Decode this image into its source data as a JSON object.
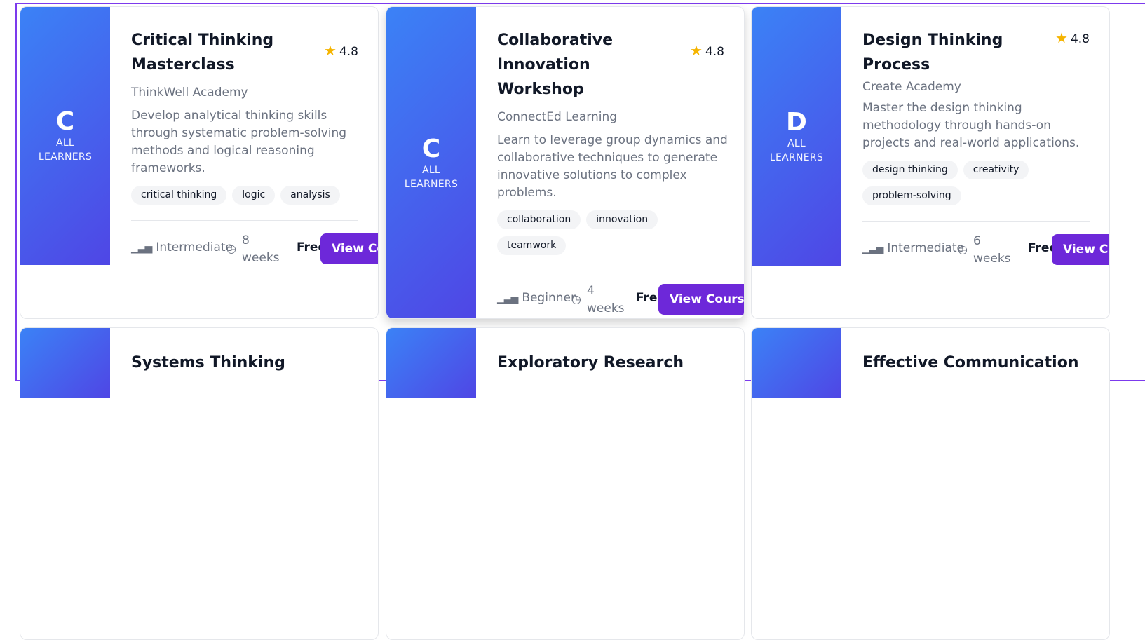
{
  "cards": [
    {
      "letter": "C",
      "audience": "ALL LEARNERS",
      "title": "Critical Thinking Masterclass",
      "rating": "4.8",
      "provider": "ThinkWell Academy",
      "description": "Develop analytical thinking skills through systematic problem-solving methods and logical reasoning frameworks.",
      "tags": [
        "critical thinking",
        "logic",
        "analysis"
      ],
      "level": "Intermediate",
      "duration": "8 weeks",
      "price": "Free",
      "button": "View Course"
    },
    {
      "letter": "C",
      "audience": "ALL LEARNERS",
      "title": "Collaborative Innovation Workshop",
      "rating": "4.8",
      "provider": "ConnectEd Learning",
      "description": "Learn to leverage group dynamics and collaborative techniques to generate innovative solutions to complex problems.",
      "tags": [
        "collaboration",
        "innovation",
        "teamwork"
      ],
      "level": "Beginner",
      "duration": "4 weeks",
      "price": "Free",
      "button": "View Course"
    },
    {
      "letter": "D",
      "audience": "ALL LEARNERS",
      "title": "Design Thinking Process",
      "rating": "4.8",
      "provider": "Create Academy",
      "description": "Master the design thinking methodology through hands-on projects and real-world applications.",
      "tags": [
        "design thinking",
        "creativity",
        "problem-solving"
      ],
      "level": "Intermediate",
      "duration": "6 weeks",
      "price": "Free",
      "button": "View Course"
    },
    {
      "title": "Systems Thinking"
    },
    {
      "title": "Exploratory Research"
    },
    {
      "title": "Effective Communication"
    }
  ],
  "icons": {
    "star": "star-icon",
    "level": "bar-chart-icon",
    "duration": "clock-icon"
  },
  "colors": {
    "accent": "#6d28d9",
    "gradient_start": "#3b82f6",
    "gradient_end": "#4f46e5",
    "star": "#f5b400"
  }
}
